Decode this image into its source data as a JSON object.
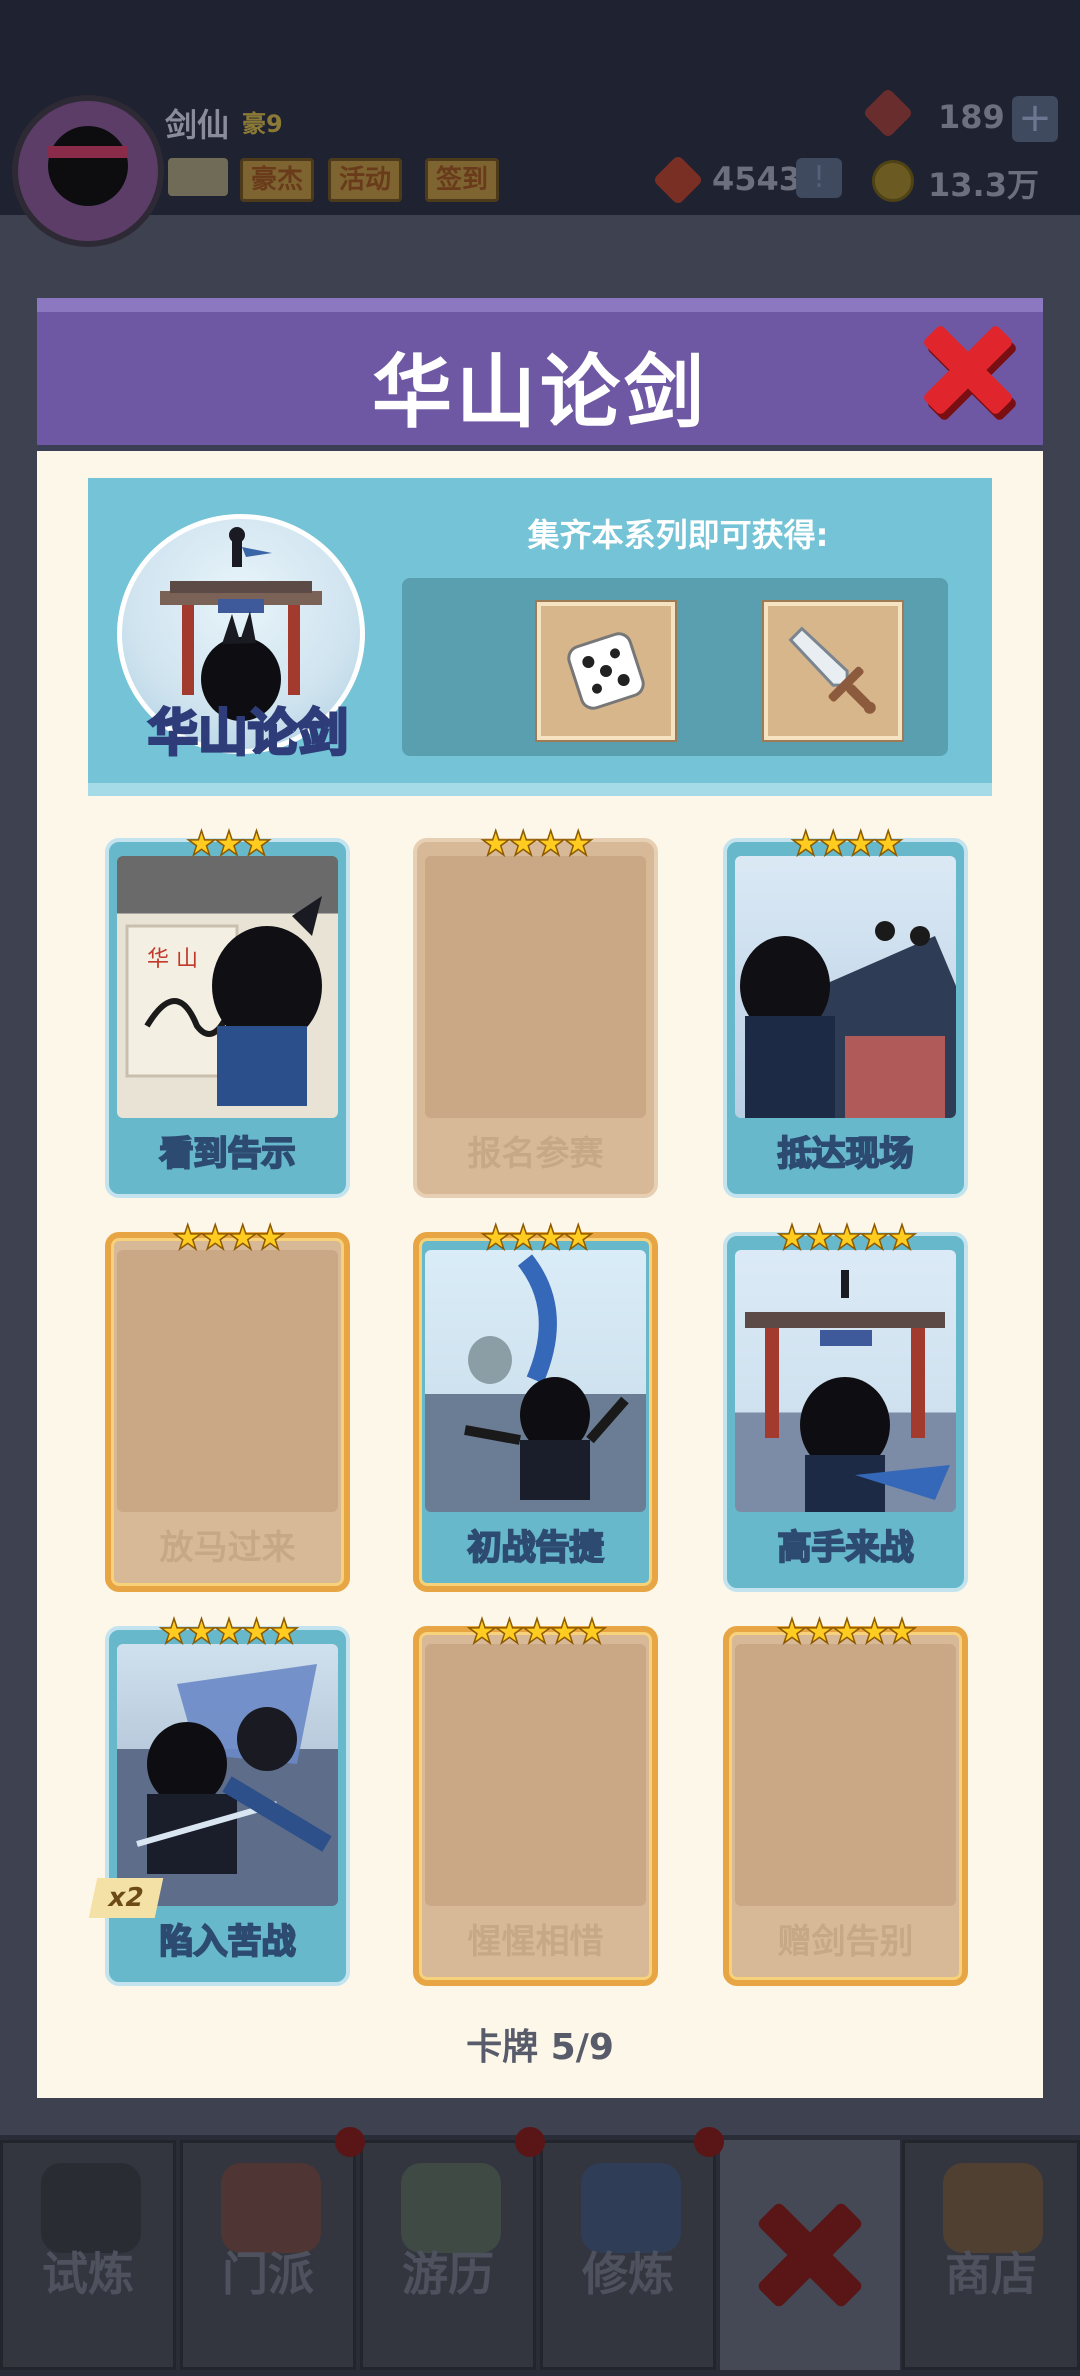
{
  "player": {
    "name": "剑仙",
    "vip": "豪9",
    "buttons": [
      "豪杰",
      "活动",
      "签到"
    ]
  },
  "resources": {
    "gems": "189",
    "tokens": "4543",
    "coins": "13.3万"
  },
  "modal": {
    "title": "华山论剑",
    "series_name": "华山论剑",
    "reward_caption": "集齐本系列即可获得:",
    "rewards": [
      {
        "icon": "dice-icon"
      },
      {
        "icon": "sword-icon"
      }
    ],
    "cards": [
      {
        "label": "看到告示",
        "stars": "★★★",
        "state": "collected"
      },
      {
        "label": "报名参赛",
        "stars": "★★★★",
        "state": "locked"
      },
      {
        "label": "抵达现场",
        "stars": "★★★★",
        "state": "collected"
      },
      {
        "label": "放马过来",
        "stars": "★★★★",
        "state": "locked"
      },
      {
        "label": "初战告捷",
        "stars": "★★★★",
        "state": "collected"
      },
      {
        "label": "高手来战",
        "stars": "★★★★★",
        "state": "collected"
      },
      {
        "label": "陷入苦战",
        "stars": "★★★★★",
        "state": "collected",
        "badge": "x2"
      },
      {
        "label": "惺惺相惜",
        "stars": "★★★★★",
        "state": "locked"
      },
      {
        "label": "赠剑告别",
        "stars": "★★★★★",
        "state": "locked"
      }
    ],
    "progress": "卡牌  5/9"
  },
  "bottom_nav": {
    "tabs": [
      "试炼",
      "门派",
      "游历",
      "修炼",
      "商店"
    ]
  },
  "colors": {
    "header": "#6e58a3",
    "banner": "#74c3d6",
    "card_blue": "#67b8ca",
    "card_locked": "#d7b997",
    "gold_frame": "#e7a544",
    "close_red": "#e0262c"
  }
}
